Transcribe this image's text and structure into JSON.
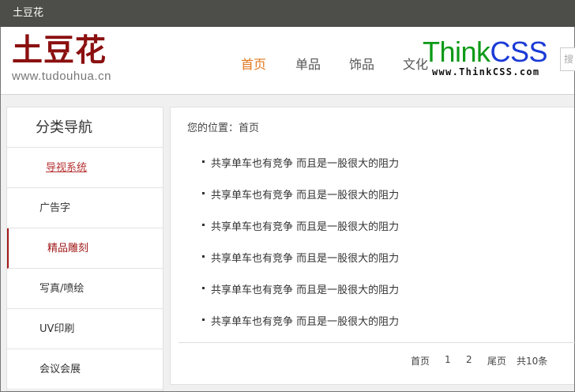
{
  "topbar": {
    "title": "土豆花"
  },
  "logo": {
    "name": "土豆花",
    "url": "www.tudouhua.cn"
  },
  "nav": {
    "items": [
      {
        "label": "首页",
        "active": true
      },
      {
        "label": "单品",
        "active": false
      },
      {
        "label": "饰品",
        "active": false
      },
      {
        "label": "文化",
        "active": false
      }
    ]
  },
  "watermark": {
    "think": "Think",
    "css": "CSS",
    "url": "www.ThinkCSS.com"
  },
  "search": {
    "placeholder": "搜"
  },
  "sidebar": {
    "title": "分类导航",
    "items": [
      {
        "label": "导视系统",
        "state": "hover"
      },
      {
        "label": "广告字",
        "state": "normal"
      },
      {
        "label": "精品雕刻",
        "state": "current"
      },
      {
        "label": "写真/喷绘",
        "state": "normal"
      },
      {
        "label": "UV印刷",
        "state": "normal"
      },
      {
        "label": "会议会展",
        "state": "normal"
      }
    ]
  },
  "breadcrumb": {
    "prefix": "您的位置：",
    "current": "首页"
  },
  "articles": [
    "共享单车也有竞争 而且是一股很大的阻力",
    "共享单车也有竞争 而且是一股很大的阻力",
    "共享单车也有竞争 而且是一股很大的阻力",
    "共享单车也有竞争 而且是一股很大的阻力",
    "共享单车也有竞争 而且是一股很大的阻力",
    "共享单车也有竞争 而且是一股很大的阻力"
  ],
  "pagination": {
    "first": "首页",
    "pages": [
      "1",
      "2"
    ],
    "last": "尾页",
    "total": "共10条"
  },
  "colors": {
    "topbar_bg": "#4d4d49",
    "logo_red": "#8b1010",
    "nav_active": "#e2781f",
    "accent_red": "#a01818"
  }
}
